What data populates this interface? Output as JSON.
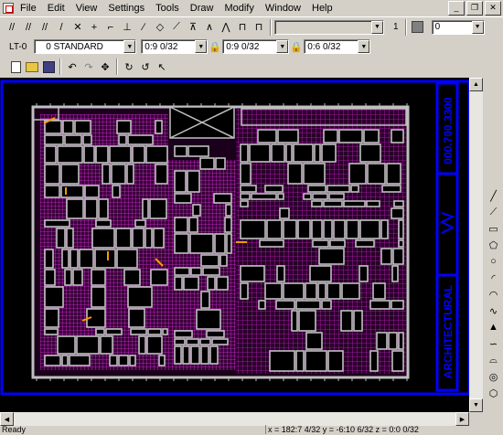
{
  "menubar": {
    "items": [
      "File",
      "Edit",
      "View",
      "Settings",
      "Tools",
      "Draw",
      "Modify",
      "Window",
      "Help"
    ]
  },
  "toolbar1": {
    "style_combo": "",
    "line_weight": "1",
    "color_value": "0"
  },
  "toolbar2": {
    "layer_label": "LT-0",
    "layer_combo": "0 STANDARD",
    "combo_a": "0:9 0/32",
    "combo_b": "0:9 0/32",
    "combo_c": "0:6 0/32"
  },
  "title_block": {
    "number": "000.700.3300",
    "name": "ARCHITECTURAL"
  },
  "statusbar": {
    "status": "Ready",
    "coords": "x = 182:7 4/32  y = -6:10 6/32  z = 0:0 0/32"
  },
  "colors": {
    "chrome": "#d4d0c8",
    "canvas": "#000000",
    "blue_border": "#0000ff",
    "walls": "#c0c0c0",
    "detail": "#cc33cc",
    "accent": "#ff9900"
  },
  "icons": {
    "toolbar1": [
      "snap-icon",
      "grid-icon",
      "ortho-icon",
      "osnap-icon",
      "polar-icon",
      "track-icon",
      "lineweight-icon",
      "model-icon",
      "zoom-icon",
      "pan-icon",
      "angle-icon",
      "dimension-icon",
      "measure-icon",
      "area-icon",
      "list-icon",
      "id-icon"
    ],
    "toolbar3": [
      "new-icon",
      "open-icon",
      "save-icon",
      "undo-icon",
      "redo-icon",
      "move-icon",
      "rotate-icon",
      "copy-icon",
      "select-icon"
    ],
    "draw": [
      "line-icon",
      "polyline-icon",
      "rectangle-icon",
      "polygon-icon",
      "circle-icon",
      "arc-icon",
      "ellipse-icon",
      "spline-icon",
      "hatch-icon",
      "text-icon",
      "point-icon",
      "block-icon",
      "insert-icon"
    ]
  }
}
